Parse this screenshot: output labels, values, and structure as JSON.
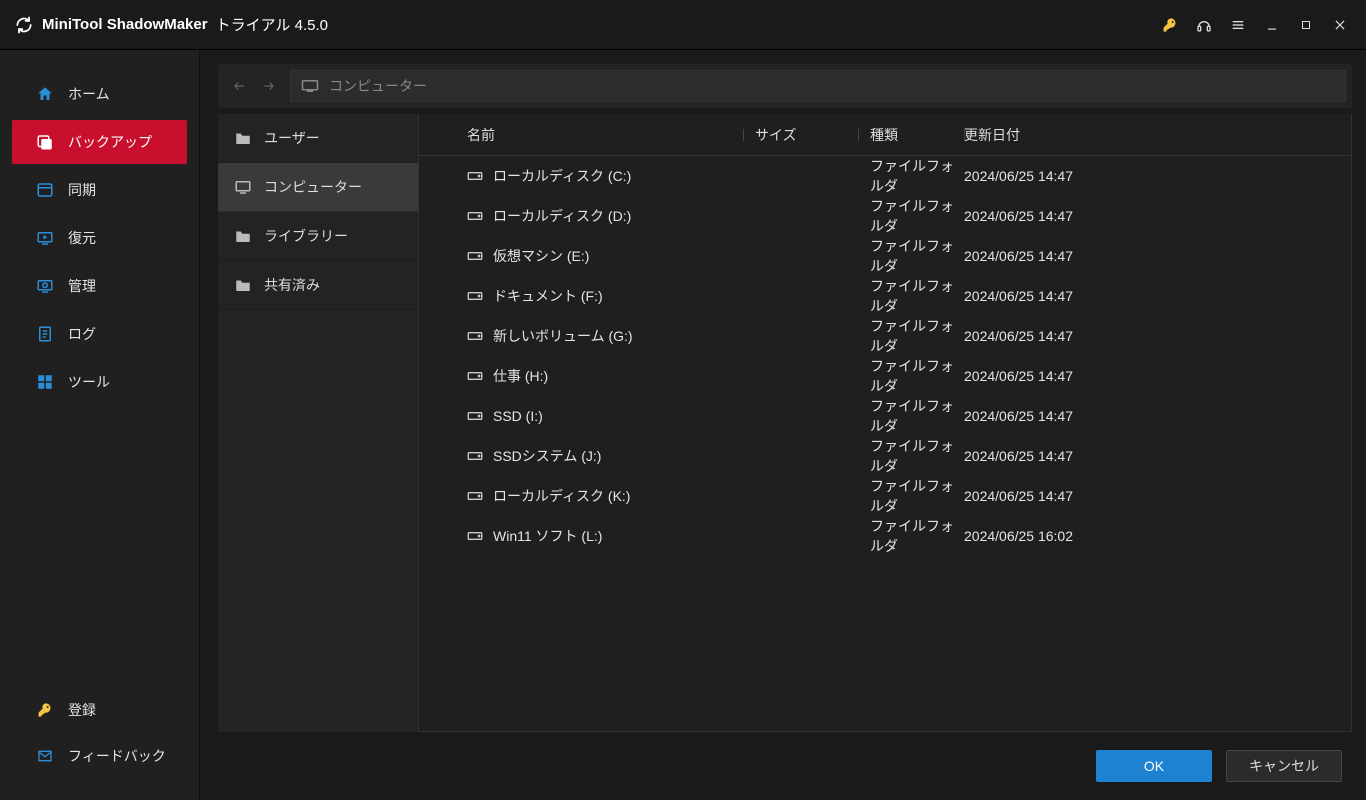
{
  "titlebar": {
    "app_name": "MiniTool ShadowMaker",
    "trial_text": "トライアル 4.5.0"
  },
  "sidebar": {
    "items": [
      {
        "label": "ホーム",
        "icon": "home"
      },
      {
        "label": "バックアップ",
        "icon": "backup",
        "active": true
      },
      {
        "label": "同期",
        "icon": "sync"
      },
      {
        "label": "復元",
        "icon": "restore"
      },
      {
        "label": "管理",
        "icon": "manage"
      },
      {
        "label": "ログ",
        "icon": "log"
      },
      {
        "label": "ツール",
        "icon": "tools"
      }
    ],
    "bottom": [
      {
        "label": "登録",
        "icon": "key"
      },
      {
        "label": "フィードバック",
        "icon": "mail"
      }
    ]
  },
  "pathbar": {
    "label": "コンピューター"
  },
  "tree": {
    "items": [
      {
        "label": "ユーザー",
        "icon": "folder-user"
      },
      {
        "label": "コンピューター",
        "icon": "computer",
        "selected": true
      },
      {
        "label": "ライブラリー",
        "icon": "folder"
      },
      {
        "label": "共有済み",
        "icon": "folder"
      }
    ]
  },
  "filelist": {
    "headers": {
      "name": "名前",
      "size": "サイズ",
      "type": "種類",
      "date": "更新日付"
    },
    "rows": [
      {
        "name": "ローカルディスク (C:)",
        "size": "",
        "type": "ファイルフォルダ",
        "date": "2024/06/25 14:47"
      },
      {
        "name": "ローカルディスク (D:)",
        "size": "",
        "type": "ファイルフォルダ",
        "date": "2024/06/25 14:47"
      },
      {
        "name": "仮想マシン (E:)",
        "size": "",
        "type": "ファイルフォルダ",
        "date": "2024/06/25 14:47"
      },
      {
        "name": "ドキュメント (F:)",
        "size": "",
        "type": "ファイルフォルダ",
        "date": "2024/06/25 14:47"
      },
      {
        "name": "新しいボリューム (G:)",
        "size": "",
        "type": "ファイルフォルダ",
        "date": "2024/06/25 14:47"
      },
      {
        "name": "仕事 (H:)",
        "size": "",
        "type": "ファイルフォルダ",
        "date": "2024/06/25 14:47"
      },
      {
        "name": "SSD (I:)",
        "size": "",
        "type": "ファイルフォルダ",
        "date": "2024/06/25 14:47"
      },
      {
        "name": "SSDシステム (J:)",
        "size": "",
        "type": "ファイルフォルダ",
        "date": "2024/06/25 14:47"
      },
      {
        "name": "ローカルディスク (K:)",
        "size": "",
        "type": "ファイルフォルダ",
        "date": "2024/06/25 14:47"
      },
      {
        "name": "Win11 ソフト (L:)",
        "size": "",
        "type": "ファイルフォルダ",
        "date": "2024/06/25 16:02"
      }
    ]
  },
  "footer": {
    "ok": "OK",
    "cancel": "キャンセル"
  }
}
